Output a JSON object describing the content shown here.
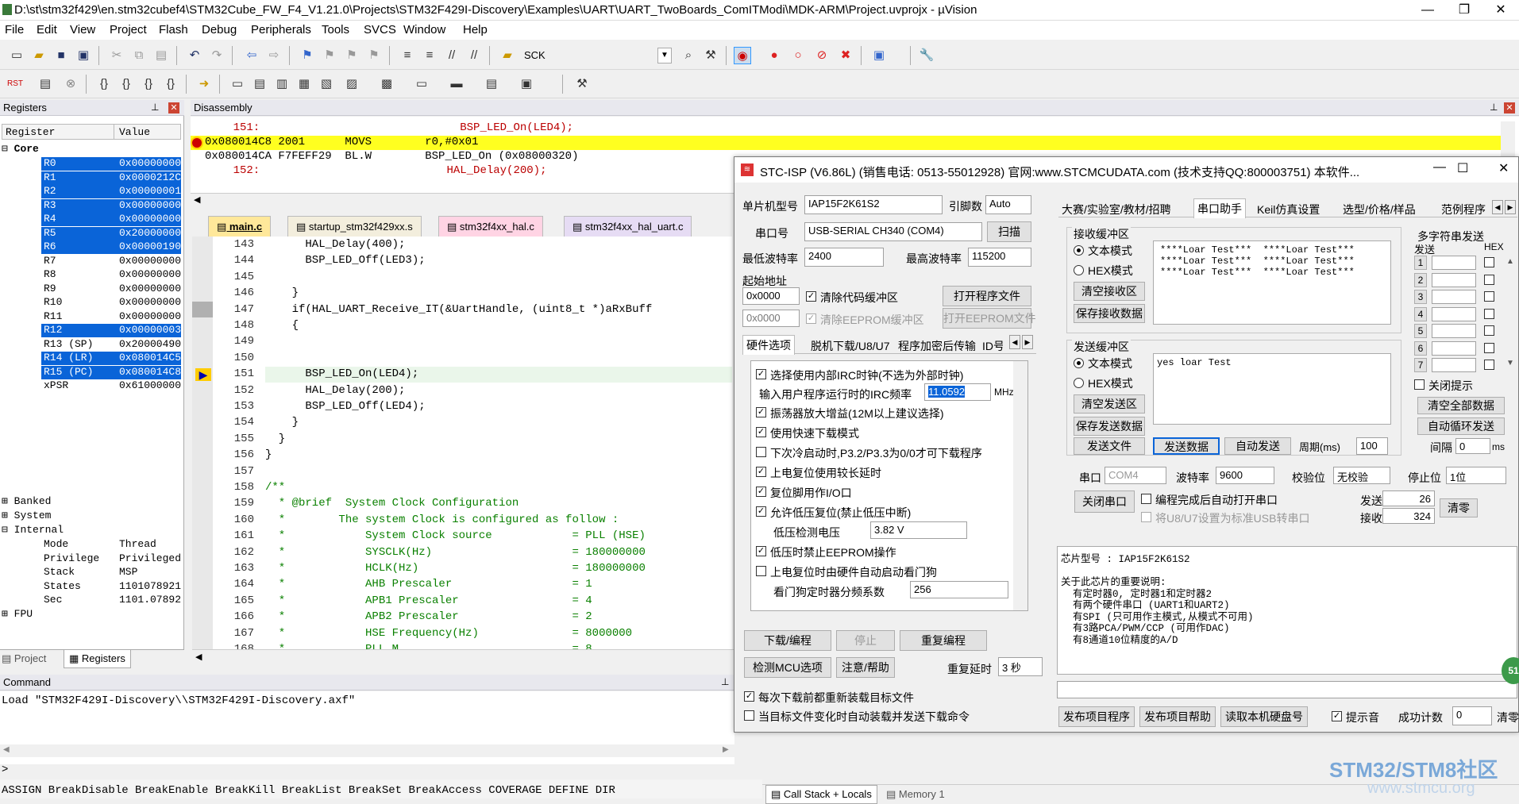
{
  "window": {
    "title": "D:\\st\\stm32f429\\en.stm32cubef4\\STM32Cube_FW_F4_V1.21.0\\Projects\\STM32F429I-Discovery\\Examples\\UART\\UART_TwoBoards_ComITModi\\MDK-ARM\\Project.uvprojx - µVision"
  },
  "menu": [
    "File",
    "Edit",
    "View",
    "Project",
    "Flash",
    "Debug",
    "Peripherals",
    "Tools",
    "SVCS",
    "Window",
    "Help"
  ],
  "toolbar": {
    "find_text": "SCK"
  },
  "registers": {
    "title": "Registers",
    "col_register": "Register",
    "col_value": "Value",
    "core_label": "Core",
    "rows": [
      {
        "name": "R0",
        "value": "0x00000000",
        "sel": true
      },
      {
        "name": "R1",
        "value": "0x0000212C",
        "sel": true
      },
      {
        "name": "R2",
        "value": "0x00000001",
        "sel": true
      },
      {
        "name": "R3",
        "value": "0x00000000",
        "sel": true
      },
      {
        "name": "R4",
        "value": "0x00000000",
        "sel": true
      },
      {
        "name": "R5",
        "value": "0x20000000",
        "sel": true
      },
      {
        "name": "R6",
        "value": "0x00000190",
        "sel": true
      },
      {
        "name": "R7",
        "value": "0x00000000",
        "sel": false
      },
      {
        "name": "R8",
        "value": "0x00000000",
        "sel": false
      },
      {
        "name": "R9",
        "value": "0x00000000",
        "sel": false
      },
      {
        "name": "R10",
        "value": "0x00000000",
        "sel": false
      },
      {
        "name": "R11",
        "value": "0x00000000",
        "sel": false
      },
      {
        "name": "R12",
        "value": "0x00000003",
        "sel": true
      },
      {
        "name": "R13 (SP)",
        "value": "0x20000490",
        "sel": false
      },
      {
        "name": "R14 (LR)",
        "value": "0x080014C5",
        "sel": true
      },
      {
        "name": "R15 (PC)",
        "value": "0x080014C8",
        "sel": true
      },
      {
        "name": "xPSR",
        "value": "0x61000000",
        "sel": false
      }
    ],
    "banked": "Banked",
    "system": "System",
    "internal": "Internal",
    "internal_rows": [
      {
        "name": "Mode",
        "value": "Thread"
      },
      {
        "name": "Privilege",
        "value": "Privileged"
      },
      {
        "name": "Stack",
        "value": "MSP"
      },
      {
        "name": "States",
        "value": "1101078921"
      },
      {
        "name": "Sec",
        "value": "1101.07892"
      }
    ],
    "fpu": "FPU",
    "tab_project": "Project",
    "tab_registers": "Registers"
  },
  "disassembly": {
    "title": "Disassembly",
    "lines": [
      "    151:                              BSP_LED_On(LED4);",
      "0x080014C8 2001      MOVS        r0,#0x01",
      "0x080014CA F7FEFF29  BL.W        BSP_LED_On (0x08000320)",
      "    152:                            HAL_Delay(200);"
    ]
  },
  "editor": {
    "tabs": [
      "main.c",
      "startup_stm32f429xx.s",
      "stm32f4xx_hal.c",
      "stm32f4xx_hal_uart.c"
    ],
    "lines": [
      {
        "n": "143",
        "t": "      HAL_Delay(400);",
        "c": ""
      },
      {
        "n": "144",
        "t": "      BSP_LED_Off(LED3);",
        "c": ""
      },
      {
        "n": "145",
        "t": "",
        "c": ""
      },
      {
        "n": "146",
        "t": "    }",
        "c": ""
      },
      {
        "n": "147",
        "t": "    if(HAL_UART_Receive_IT(&UartHandle, (uint8_t *)aRxBuff",
        "c": ""
      },
      {
        "n": "148",
        "t": "    {",
        "c": ""
      },
      {
        "n": "149",
        "t": "",
        "c": ""
      },
      {
        "n": "150",
        "t": "",
        "c": ""
      },
      {
        "n": "151",
        "t": "      BSP_LED_On(LED4);",
        "c": ""
      },
      {
        "n": "152",
        "t": "      HAL_Delay(200);",
        "c": ""
      },
      {
        "n": "153",
        "t": "      BSP_LED_Off(LED4);",
        "c": ""
      },
      {
        "n": "154",
        "t": "    }",
        "c": ""
      },
      {
        "n": "155",
        "t": "  }",
        "c": ""
      },
      {
        "n": "156",
        "t": "}",
        "c": ""
      },
      {
        "n": "157",
        "t": "",
        "c": ""
      },
      {
        "n": "158",
        "t": "/**",
        "c": "cm"
      },
      {
        "n": "159",
        "t": "  * @brief  System Clock Configuration",
        "c": "cm"
      },
      {
        "n": "160",
        "t": "  *        The system Clock is configured as follow :",
        "c": "cm"
      },
      {
        "n": "161",
        "t": "  *            System Clock source            = PLL (HSE)",
        "c": "cm"
      },
      {
        "n": "162",
        "t": "  *            SYSCLK(Hz)                     = 180000000",
        "c": "cm"
      },
      {
        "n": "163",
        "t": "  *            HCLK(Hz)                       = 180000000",
        "c": "cm"
      },
      {
        "n": "164",
        "t": "  *            AHB Prescaler                  = 1",
        "c": "cm"
      },
      {
        "n": "165",
        "t": "  *            APB1 Prescaler                 = 4",
        "c": "cm"
      },
      {
        "n": "166",
        "t": "  *            APB2 Prescaler                 = 2",
        "c": "cm"
      },
      {
        "n": "167",
        "t": "  *            HSE Frequency(Hz)              = 8000000",
        "c": "cm"
      },
      {
        "n": "168",
        "t": "  *            PLL_M                          = 8",
        "c": "cm"
      }
    ]
  },
  "command": {
    "title": "Command",
    "output": "Load \"STM32F429I-Discovery\\\\STM32F429I-Discovery.axf\"",
    "prompt": ">",
    "keywords": "ASSIGN BreakDisable BreakEnable BreakKill BreakList BreakSet BreakAccess COVERAGE DEFINE DIR",
    "tab_callstack": "Call Stack + Locals",
    "tab_memory": "Memory 1"
  },
  "stc": {
    "title": "STC-ISP (V6.86L) (销售电话: 0513-55012928) 官网:www.STCMCUDATA.com  (技术支持QQ:800003751) 本软件...",
    "mcu_label": "单片机型号",
    "mcu_value": "IAP15F2K61S2",
    "pin_label": "引脚数",
    "pin_value": "Auto",
    "port_label": "串口号",
    "port_value": "USB-SERIAL CH340 (COM4)",
    "scan": "扫描",
    "min_baud_label": "最低波特率",
    "min_baud": "2400",
    "max_baud_label": "最高波特率",
    "max_baud": "115200",
    "start_addr_label": "起始地址",
    "addr1": "0x0000",
    "clear_code": "清除代码缓冲区",
    "open_prog": "打开程序文件",
    "addr2": "0x0000",
    "clear_eeprom": "清除EEPROM缓冲区",
    "open_eeprom": "打开EEPROM文件",
    "hw_tabs": [
      "硬件选项",
      "脱机下载/U8/U7",
      "程序加密后传输",
      "ID号"
    ],
    "opt1": "选择使用内部IRC时钟(不选为外部时钟)",
    "irc_label": "输入用户程序运行时的IRC频率",
    "irc_value": "11.0592",
    "irc_unit": "MHz",
    "opt2": "振荡器放大增益(12M以上建议选择)",
    "opt3": "使用快速下载模式",
    "opt4": "下次冷启动时,P3.2/P3.3为0/0才可下载程序",
    "opt5": "上电复位使用较长延时",
    "opt6": "复位脚用作I/O口",
    "opt7": "允许低压复位(禁止低压中断)",
    "lvd_label": "低压检测电压",
    "lvd_value": "3.82 V",
    "opt8": "低压时禁止EEPROM操作",
    "opt9": "上电复位时由硬件自动启动看门狗",
    "wdt_label": "看门狗定时器分频系数",
    "wdt_value": "256",
    "download": "下载/编程",
    "stop": "停止",
    "reprogram": "重复编程",
    "detect": "检测MCU选项",
    "help": "注意/帮助",
    "repeat_delay_label": "重复延时",
    "repeat_delay": "3 秒",
    "reload": "每次下载前都重新装载目标文件",
    "autoload": "当目标文件变化时自动装载并发送下载命令",
    "right_tabs": [
      "大赛/实验室/教材/招聘",
      "串口助手",
      "Keil仿真设置",
      "选型/价格/样品",
      "范例程序"
    ],
    "recv_title": "接收缓冲区",
    "recv_text_mode": "文本模式",
    "recv_hex_mode": "HEX模式",
    "clear_recv": "清空接收区",
    "save_recv": "保存接收数据",
    "recv_lines": [
      "****Loar Test***  ****Loar Test***",
      "****Loar Test***  ****Loar Test***",
      "****Loar Test***  ****Loar Test***"
    ],
    "send_title": "发送缓冲区",
    "send_text_mode": "文本模式",
    "send_hex_mode": "HEX模式",
    "clear_send": "清空发送区",
    "save_send": "保存发送数据",
    "send_text": "yes loar Test",
    "send_file": "发送文件",
    "send_data": "发送数据",
    "auto_send": "自动发送",
    "period_label": "周期(ms)",
    "period": "100",
    "multi_title": "多字符串发送",
    "multi_send": "发送",
    "multi_hex": "HEX",
    "multi_nums": [
      "1",
      "2",
      "3",
      "4",
      "5",
      "6",
      "7"
    ],
    "close_tip": "关闭提示",
    "clear_all": "清空全部数据",
    "auto_loop": "自动循环发送",
    "interval_label": "间隔",
    "interval": "0",
    "interval_unit": "ms",
    "serial_label": "串口",
    "serial_value": "COM4",
    "baud_label": "波特率",
    "baud_value": "9600",
    "parity_label": "校验位",
    "parity_value": "无校验",
    "stop_label": "停止位",
    "stop_value": "1位",
    "close_port": "关闭串口",
    "auto_open": "编程完成后自动打开串口",
    "usb_cdc": "将U8/U7设置为标准USB转串口",
    "sent_label": "发送",
    "sent_count": "26",
    "recv_label": "接收",
    "recv_count": "324",
    "clear_count": "清零",
    "chip_info": [
      "芯片型号 : IAP15F2K61S2",
      "",
      "关于此芯片的重要说明:",
      "  有定时器0, 定时器1和定时器2",
      "  有两个硬件串口 (UART1和UART2)",
      "  有SPI (只可用作主模式,从模式不可用)",
      "  有3路PCA/PWM/CCP (可用作DAC)",
      "  有8通道10位精度的A/D"
    ],
    "publish_prog": "发布项目程序",
    "publish_help": "发布项目帮助",
    "read_disk": "读取本机硬盘号",
    "beep": "提示音",
    "success_label": "成功计数",
    "success_count": "0",
    "clear_success": "清零",
    "badge": "51"
  },
  "watermark": {
    "line1": "STM32/STM8社区",
    "line2": "www.stmcu.org"
  }
}
